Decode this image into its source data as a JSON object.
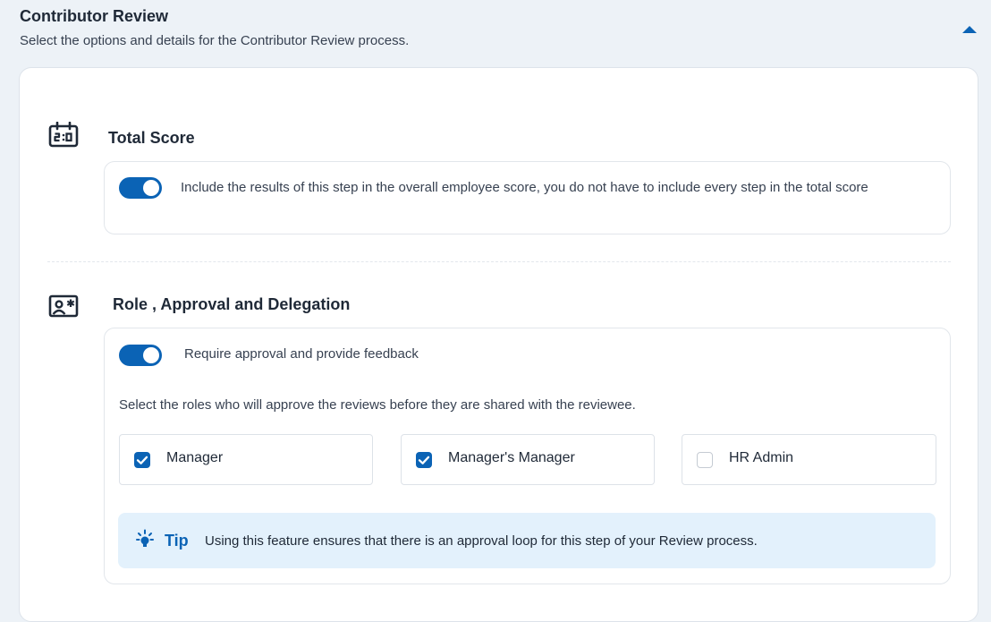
{
  "header": {
    "title": "Contributor Review",
    "subtitle": "Select the options and details for the Contributor Review process.",
    "collapse_icon": "chevron-up-icon"
  },
  "total_score": {
    "title": "Total Score",
    "icon": "scoreboard-icon",
    "toggle_on": true,
    "description": "Include the results of this step in the overall employee score, you do not have to include every step in the total score"
  },
  "approval": {
    "title": "Role , Approval and Delegation",
    "icon": "profile-card-icon",
    "toggle_on": true,
    "toggle_label": "Require approval and provide feedback",
    "instructions": "Select the roles who will approve the reviews before they are shared with the reviewee.",
    "roles": [
      {
        "label": "Manager",
        "checked": true
      },
      {
        "label": "Manager's Manager",
        "checked": true
      },
      {
        "label": "HR Admin",
        "checked": false
      }
    ],
    "tip": {
      "icon": "lightbulb-icon",
      "label": "Tip",
      "text": "Using this feature ensures that there is an approval loop for this step of your Review process."
    }
  },
  "colors": {
    "accent": "#0b63b5",
    "page_background": "#edf2f7",
    "tip_background": "#e3f1fc"
  }
}
